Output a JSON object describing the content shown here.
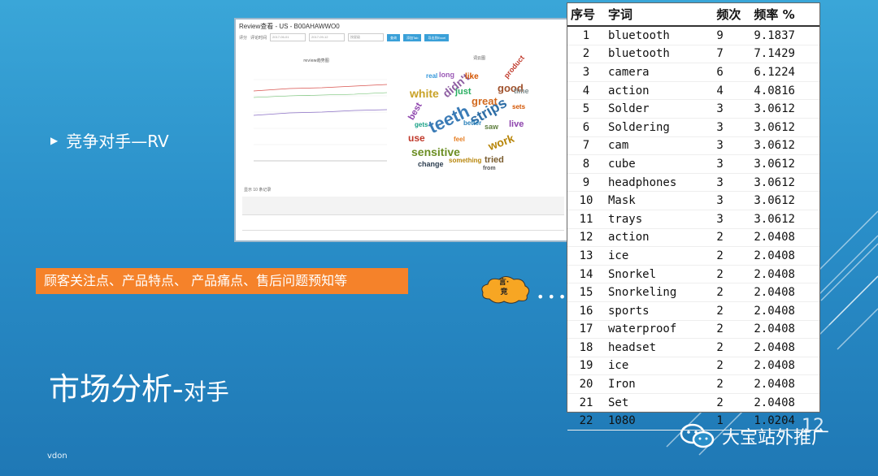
{
  "slide": {
    "bullet": "竞争对手—RV",
    "banner": "顾客关注点、产品特点、 产品痛点、售后问题预知等",
    "title_main": "市场分析-",
    "title_small": "对手",
    "footer": "vdon",
    "page_number": "12",
    "brand": "大宝站外推广",
    "bubble_text": "言·竞"
  },
  "screenshot": {
    "title": "Review查看 - US - B00AHAWWO0",
    "toolbar_label1": "评分",
    "toolbar_label2": "评论时间",
    "field1": "2017-06-01",
    "field2": "2017-09-12",
    "field3": "按星级",
    "btn1": "查询",
    "btn2": "添加Tab",
    "btn3": "导出到Excel",
    "chart_title": "review趋势图",
    "cloud_title": "词云图",
    "sub_label": "显示 10 条记录",
    "words": [
      "teeth",
      "strips",
      "sensitive",
      "white",
      "didn't",
      "great",
      "good",
      "work",
      "use",
      "best",
      "tried",
      "saw",
      "like",
      "change",
      "long",
      "feel",
      "real",
      "gets",
      "sets",
      "just",
      "product",
      "live",
      "time",
      "something",
      "from",
      "better"
    ]
  },
  "freq_table": {
    "headers": [
      "序号",
      "字词",
      "频次",
      "频率 %"
    ],
    "rows": [
      [
        "1",
        "bluetooth",
        "9",
        "9.1837"
      ],
      [
        "2",
        "bluetooth",
        "7",
        "7.1429"
      ],
      [
        "3",
        "camera",
        "6",
        "6.1224"
      ],
      [
        "4",
        "action",
        "4",
        "4.0816"
      ],
      [
        "5",
        "Solder",
        "3",
        "3.0612"
      ],
      [
        "6",
        "Soldering",
        "3",
        "3.0612"
      ],
      [
        "7",
        "cam",
        "3",
        "3.0612"
      ],
      [
        "8",
        "cube",
        "3",
        "3.0612"
      ],
      [
        "9",
        "headphones",
        "3",
        "3.0612"
      ],
      [
        "10",
        "Mask",
        "3",
        "3.0612"
      ],
      [
        "11",
        "trays",
        "3",
        "3.0612"
      ],
      [
        "12",
        "action",
        "2",
        "2.0408"
      ],
      [
        "13",
        "ice",
        "2",
        "2.0408"
      ],
      [
        "14",
        "Snorkel",
        "2",
        "2.0408"
      ],
      [
        "15",
        "Snorkeling",
        "2",
        "2.0408"
      ],
      [
        "16",
        "sports",
        "2",
        "2.0408"
      ],
      [
        "17",
        "waterproof",
        "2",
        "2.0408"
      ],
      [
        "18",
        "headset",
        "2",
        "2.0408"
      ],
      [
        "19",
        "ice",
        "2",
        "2.0408"
      ],
      [
        "20",
        "Iron",
        "2",
        "2.0408"
      ],
      [
        "21",
        "Set",
        "2",
        "2.0408"
      ],
      [
        "22",
        "1080",
        "1",
        "1.0204"
      ]
    ]
  },
  "icons": {
    "bullet": "triangle-bullet-icon",
    "brand": "wechat-icon",
    "bubble": "cloud-bubble-icon"
  },
  "colors": {
    "banner": "#f5822a",
    "background_top": "#3aa6d8",
    "background_bottom": "#1f78b5"
  }
}
